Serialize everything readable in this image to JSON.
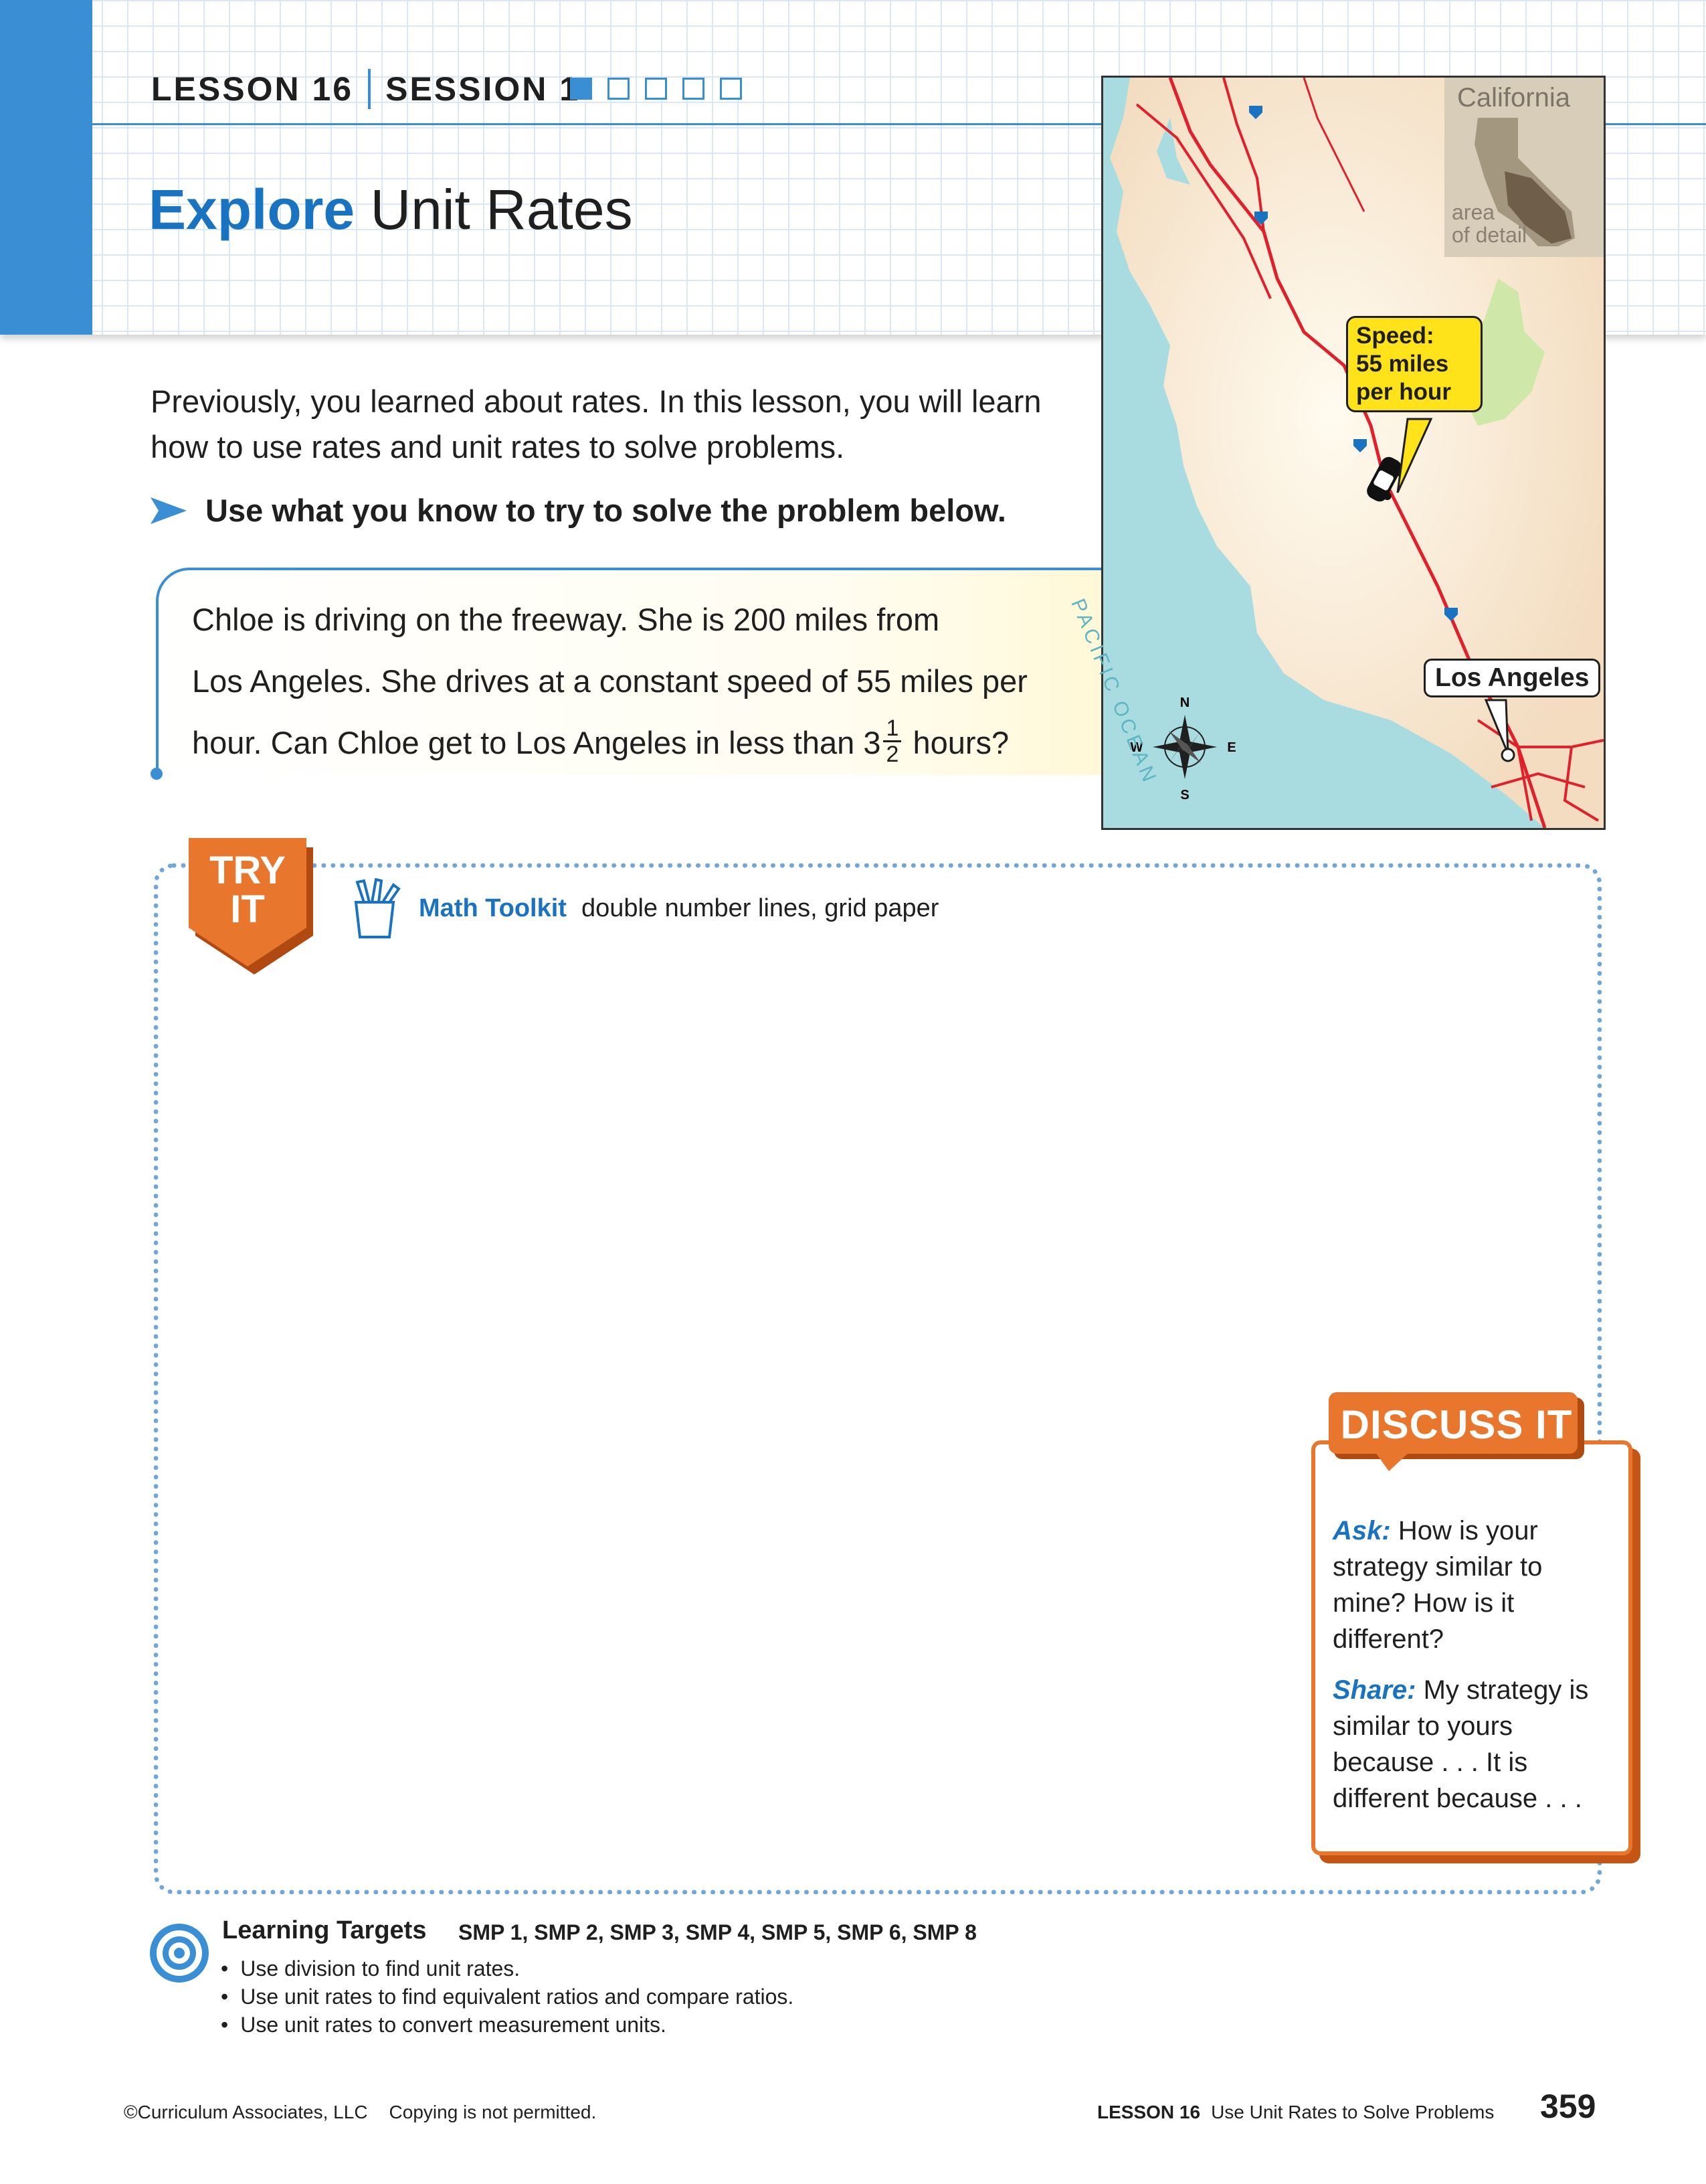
{
  "header": {
    "lesson": "LESSON 16",
    "session": "SESSION 1",
    "session_boxes": [
      true,
      false,
      false,
      false,
      false
    ],
    "title_bold": "Explore",
    "title_rest": " Unit Rates",
    "accent_color": "#3a8fd4"
  },
  "intro": {
    "text": "Previously, you learned about rates. In this lesson, you will learn how to use rates and unit rates to solve problems.",
    "instruction": "Use what you know to try to solve the problem below."
  },
  "problem": {
    "line1": "Chloe is driving on the freeway. She is 200 miles from",
    "line2": "Los Angeles. She drives at a constant speed of 55 miles per",
    "line3_start": "hour. Can Chloe get to Los Angeles in less than 3",
    "frac_num": "1",
    "frac_den": "2",
    "line3_end": " hours?"
  },
  "map": {
    "inset_title": "California",
    "inset_caption_1": "area",
    "inset_caption_2": "of detail",
    "speed_1": "Speed:",
    "speed_2": "55 miles",
    "speed_3": "per hour",
    "ocean": "PACIFIC OCEAN",
    "city": "Los Angeles",
    "compass": {
      "n": "N",
      "s": "S",
      "e": "E",
      "w": "W"
    },
    "icons": [
      "car-icon",
      "compass-rose-icon",
      "highway-marker-icon"
    ]
  },
  "try_it": {
    "badge_1": "TRY",
    "badge_2": "IT",
    "toolkit_label": "Math Toolkit",
    "toolkit_items": "double number lines, grid paper",
    "badge_color": "#e8762c"
  },
  "discuss": {
    "title": "DISCUSS IT",
    "ask_label": "Ask:",
    "ask_text": " How is your strategy similar to mine? How is it different?",
    "share_label": "Share:",
    "share_text": " My strategy is similar to yours because . . . It is different because . . ."
  },
  "learning_targets": {
    "heading": "Learning Targets",
    "smp": "SMP 1, SMP 2, SMP 3, SMP 4, SMP 5, SMP 6, SMP 8",
    "items": [
      "Use division to find unit rates.",
      "Use unit rates to find equivalent ratios and compare ratios.",
      "Use unit rates to convert measurement units."
    ]
  },
  "footer": {
    "copyright": "©Curriculum Associates, LLC",
    "notice": "Copying is not permitted.",
    "lesson": "LESSON 16",
    "lesson_title": "Use Unit Rates to Solve Problems",
    "page_number": "359"
  }
}
